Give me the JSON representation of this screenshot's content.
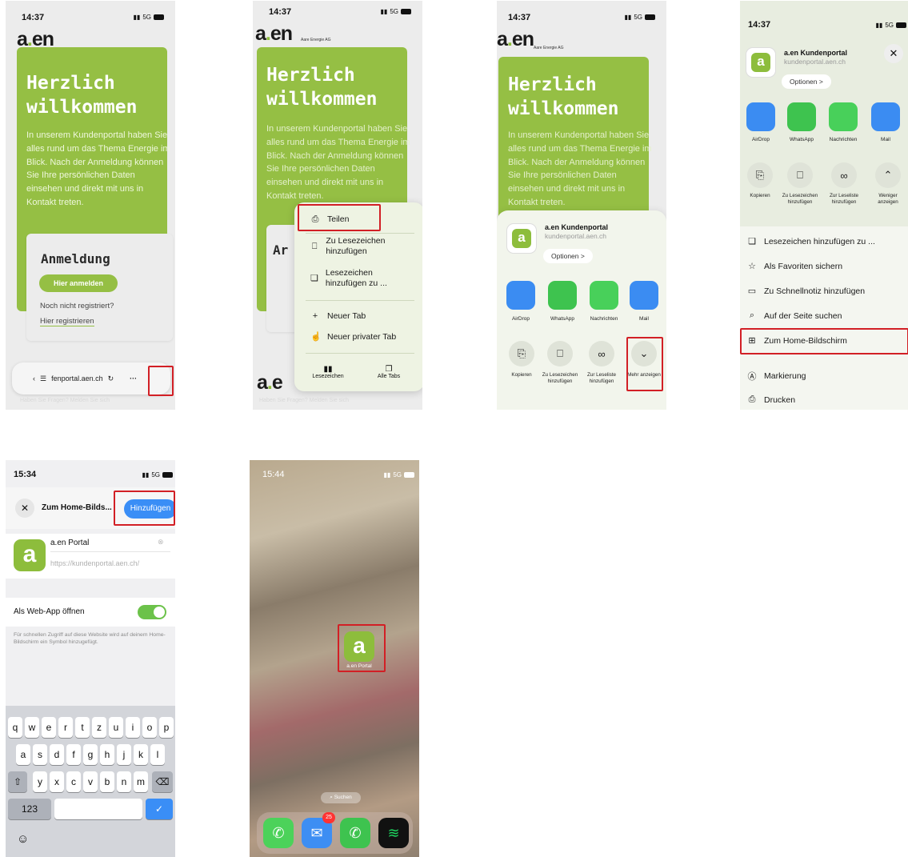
{
  "status": {
    "time1": "14:37",
    "time5": "15:34",
    "time6": "15:44",
    "network": "5G"
  },
  "site": {
    "logo": "a.en",
    "company": "Aare Energie AG",
    "hero_title": "Herzlich willkommen",
    "hero_text": "In unserem Kundenportal haben Sie alles rund um das Thema Energie im Blick. Nach der Anmeldung können Sie Ihre persönlichen Daten einsehen und direkt mit uns in Kontakt treten.",
    "login_title": "Anmeldung",
    "login_button": "Hier anmelden",
    "not_registered": "Noch nicht registriert?",
    "register_link": "Hier registrieren",
    "url": "fenportal.aen.ch",
    "footer": "Haben Sie Fragen? Melden Sie sich"
  },
  "menu": {
    "share": "Teilen",
    "add_bookmark": "Zu Lesezeichen hinzufügen",
    "add_bookmark_to": "Lesezeichen hinzufügen zu ...",
    "new_tab": "Neuer Tab",
    "new_private_tab": "Neuer privater Tab",
    "bookmarks": "Lesezeichen",
    "all_tabs": "Alle Tabs"
  },
  "share": {
    "title": "a.en Kundenportal",
    "domain": "kundenportal.aen.ch",
    "options": "Optionen >",
    "apps": [
      "AirDrop",
      "WhatsApp",
      "Nachrichten",
      "Mail"
    ],
    "actions": [
      "Kopieren",
      "Zu Lesezeichen hinzufügen",
      "Zur Leseliste hinzufügen",
      "Mehr anzeigen"
    ],
    "actions_expanded_last": "Weniger anzeigen",
    "list": [
      "Lesezeichen hinzufügen zu ...",
      "Als Favoriten sichern",
      "Zu Schnellnotiz hinzufügen",
      "Auf der Seite suchen",
      "Zum Home-Bildschirm",
      "Markierung",
      "Drucken"
    ]
  },
  "add_home": {
    "title": "Zum Home-Bilds...",
    "add": "Hinzufügen",
    "name": "a.en Portal",
    "url": "https://kundenportal.aen.ch/",
    "webapp": "Als Web-App öffnen",
    "hint": "Für schnellen Zugriff auf diese Website wird auf deinem Home-Bildschirm ein Symbol hinzugefügt.",
    "num_key": "123"
  },
  "home": {
    "app_label": "a.en Portal",
    "search": "Suchen",
    "badge": "25"
  },
  "keyboard": {
    "row1": [
      "q",
      "w",
      "e",
      "r",
      "t",
      "z",
      "u",
      "i",
      "o",
      "p"
    ],
    "row2": [
      "a",
      "s",
      "d",
      "f",
      "g",
      "h",
      "j",
      "k",
      "l"
    ],
    "row3": [
      "y",
      "x",
      "c",
      "v",
      "b",
      "n",
      "m"
    ]
  },
  "colors": {
    "brand": "#95bf44",
    "highlight": "#d21f25"
  }
}
